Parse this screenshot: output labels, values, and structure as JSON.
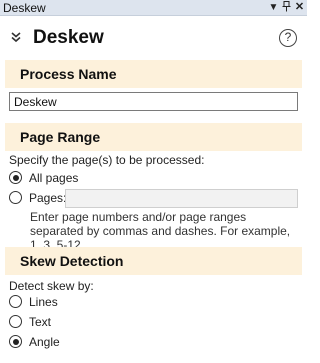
{
  "window": {
    "title": "Deskew",
    "icons": [
      "dropdown-arrow-icon",
      "pin-icon",
      "close-icon"
    ]
  },
  "header": {
    "title": "Deskew",
    "collapse_icon": "double-chevron-icon",
    "help_label": "?"
  },
  "process_name": {
    "section_title": "Process Name",
    "value": "Deskew"
  },
  "page_range": {
    "section_title": "Page Range",
    "description": "Specify the page(s) to be processed:",
    "options": [
      {
        "label": "All pages",
        "checked": true
      },
      {
        "label": "Pages:",
        "checked": false
      }
    ],
    "pages_value": "",
    "help_text": "Enter page numbers and/or page ranges separated by commas and dashes.  For example, 1, 3, 5-12"
  },
  "skew_detection": {
    "section_title": "Skew Detection",
    "description": "Detect skew by:",
    "options": [
      {
        "label": "Lines",
        "checked": false
      },
      {
        "label": "Text",
        "checked": false
      },
      {
        "label": "Angle",
        "checked": true
      }
    ]
  },
  "colors": {
    "section_band": "#fdf1db",
    "titlebar": "#dde4ee"
  }
}
